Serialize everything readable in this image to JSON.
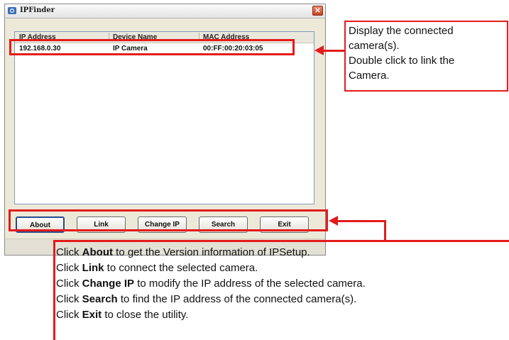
{
  "window": {
    "title": "IPFinder",
    "close_glyph": "✕",
    "icon": "app-magnifier-icon"
  },
  "list": {
    "columns": [
      "IP Address",
      "Device Name",
      "MAC Address"
    ],
    "rows": [
      [
        "192.168.0.30",
        "IP Camera",
        "00:FF:00:20:03:05"
      ]
    ]
  },
  "buttons": {
    "about": "About",
    "link": "Link",
    "change_ip": "Change IP",
    "search": "Search",
    "exit": "Exit"
  },
  "callout_top": {
    "line1": "Display the connected",
    "line2": "camera(s).",
    "line3": "Double click to link the",
    "line4": "Camera."
  },
  "instructions": [
    {
      "prefix": "Click ",
      "keyword": "About",
      "suffix": " to get the Version information of IPSetup."
    },
    {
      "prefix": "Click ",
      "keyword": "Link",
      "suffix": " to connect the selected camera."
    },
    {
      "prefix": "Click ",
      "keyword": "Change IP",
      "suffix": " to modify the IP address of the selected camera."
    },
    {
      "prefix": "Click ",
      "keyword": "Search",
      "suffix": " to find the IP address of the connected camera(s)."
    },
    {
      "prefix": "Click ",
      "keyword": "Exit",
      "suffix": " to close the utility."
    }
  ],
  "colors": {
    "annotation_red": "#e41b1b",
    "window_bg": "#ece9d8"
  }
}
